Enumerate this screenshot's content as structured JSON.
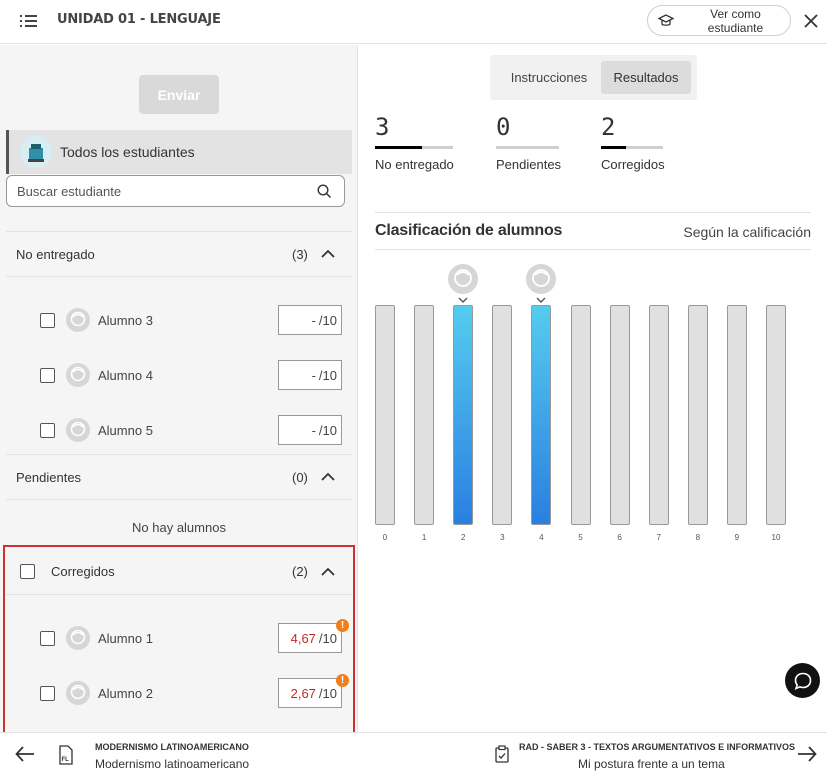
{
  "header": {
    "title": "UNIDAD 01 - LENGUAJE",
    "student_view_label": "Ver como estudiante"
  },
  "left": {
    "send_label": "Enviar",
    "all_students_label": "Todos los estudiantes",
    "search_placeholder": "Buscar estudiante",
    "sections": {
      "no_entregado": {
        "title": "No entregado",
        "count": "(3)",
        "students": [
          {
            "name": "Alumno 3",
            "grade": "-",
            "max": "/10"
          },
          {
            "name": "Alumno 4",
            "grade": "-",
            "max": "/10"
          },
          {
            "name": "Alumno 5",
            "grade": "-",
            "max": "/10"
          }
        ]
      },
      "pendientes": {
        "title": "Pendientes",
        "count": "(0)",
        "empty_text": "No hay alumnos"
      },
      "corregidos": {
        "title": "Corregidos",
        "count": "(2)",
        "students": [
          {
            "name": "Alumno 1",
            "grade": "4,67",
            "max": "/10",
            "alert": "!"
          },
          {
            "name": "Alumno 2",
            "grade": "2,67",
            "max": "/10",
            "alert": "!"
          }
        ]
      }
    }
  },
  "right": {
    "tabs": [
      {
        "label": "Instrucciones",
        "active": false
      },
      {
        "label": "Resultados",
        "active": true
      }
    ],
    "stats": [
      {
        "value": "3",
        "label": "No entregado",
        "fraction": 0.6
      },
      {
        "value": "0",
        "label": "Pendientes",
        "fraction": 0
      },
      {
        "value": "2",
        "label": "Corregidos",
        "fraction": 0.4
      }
    ],
    "ranking_title": "Clasificación de alumnos",
    "ranking_sort": "Según la calificación"
  },
  "chart_data": {
    "type": "bar",
    "categories": [
      "0",
      "1",
      "2",
      "3",
      "4",
      "5",
      "6",
      "7",
      "8",
      "9",
      "10"
    ],
    "series": [
      {
        "values": [
          0,
          0,
          1,
          0,
          1,
          0,
          0,
          0,
          0,
          0,
          0
        ]
      }
    ],
    "highlighted": [
      "2",
      "4"
    ],
    "colors": {
      "highlight_top": "#55ccef",
      "highlight_bottom": "#2a7fe0",
      "empty": "#e0e0e0"
    }
  },
  "footer": {
    "prev_kicker": "MODERNISMO LATINOAMERICANO",
    "prev_title": "Modernismo latinoamericano",
    "prev_icon_text": "FL",
    "next_kicker": "RAD - SABER 3 - TEXTOS ARGUMENTATIVOS E INFORMATIVOS",
    "next_title": "Mi postura frente a un tema"
  },
  "colors": {
    "alert": "#f07f1c",
    "grade_red": "#c62828",
    "highlight_frame": "#d32f2f"
  }
}
